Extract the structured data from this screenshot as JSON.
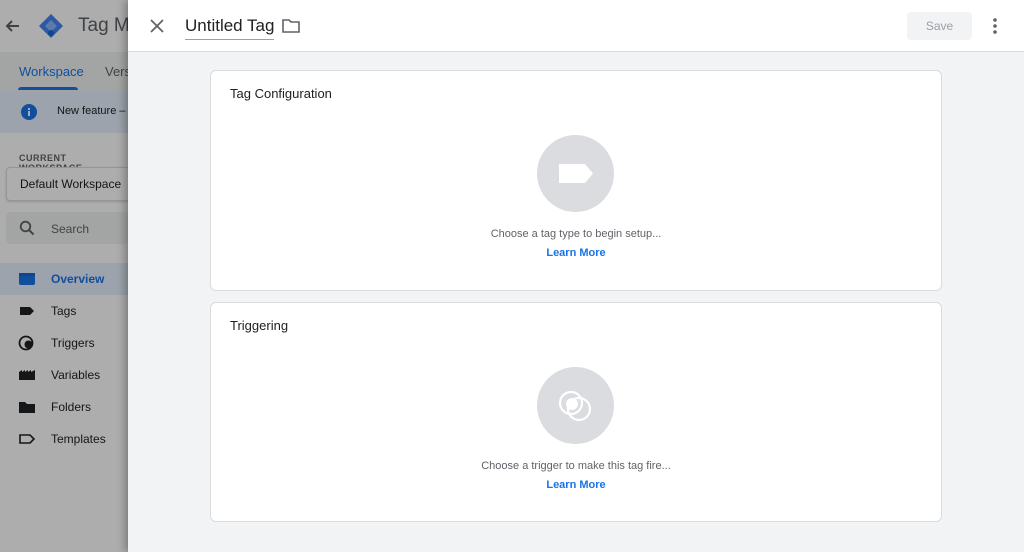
{
  "background_app": {
    "product_name": "Tag Manager",
    "tabs": [
      {
        "label": "Workspace"
      },
      {
        "label": "Versions"
      }
    ],
    "banner_text": "New feature –",
    "workspace_label": "CURRENT WORKSPACE",
    "workspace_name": "Default Workspace",
    "search_placeholder": "Search",
    "nav": [
      {
        "label": "Overview",
        "icon": "overview-icon",
        "active": true
      },
      {
        "label": "Tags",
        "icon": "tag-icon"
      },
      {
        "label": "Triggers",
        "icon": "trigger-icon"
      },
      {
        "label": "Variables",
        "icon": "variables-icon"
      },
      {
        "label": "Folders",
        "icon": "folder-icon"
      },
      {
        "label": "Templates",
        "icon": "template-icon"
      }
    ]
  },
  "panel": {
    "title": "Untitled Tag",
    "save_label": "Save",
    "tag_config": {
      "title": "Tag Configuration",
      "prompt": "Choose a tag type to begin setup...",
      "link": "Learn More"
    },
    "triggering": {
      "title": "Triggering",
      "prompt": "Choose a trigger to make this tag fire...",
      "link": "Learn More"
    }
  },
  "colors": {
    "accent": "#1a73e8",
    "panel_bg": "#f1f3f4",
    "placeholder_circle": "#dadce0"
  }
}
